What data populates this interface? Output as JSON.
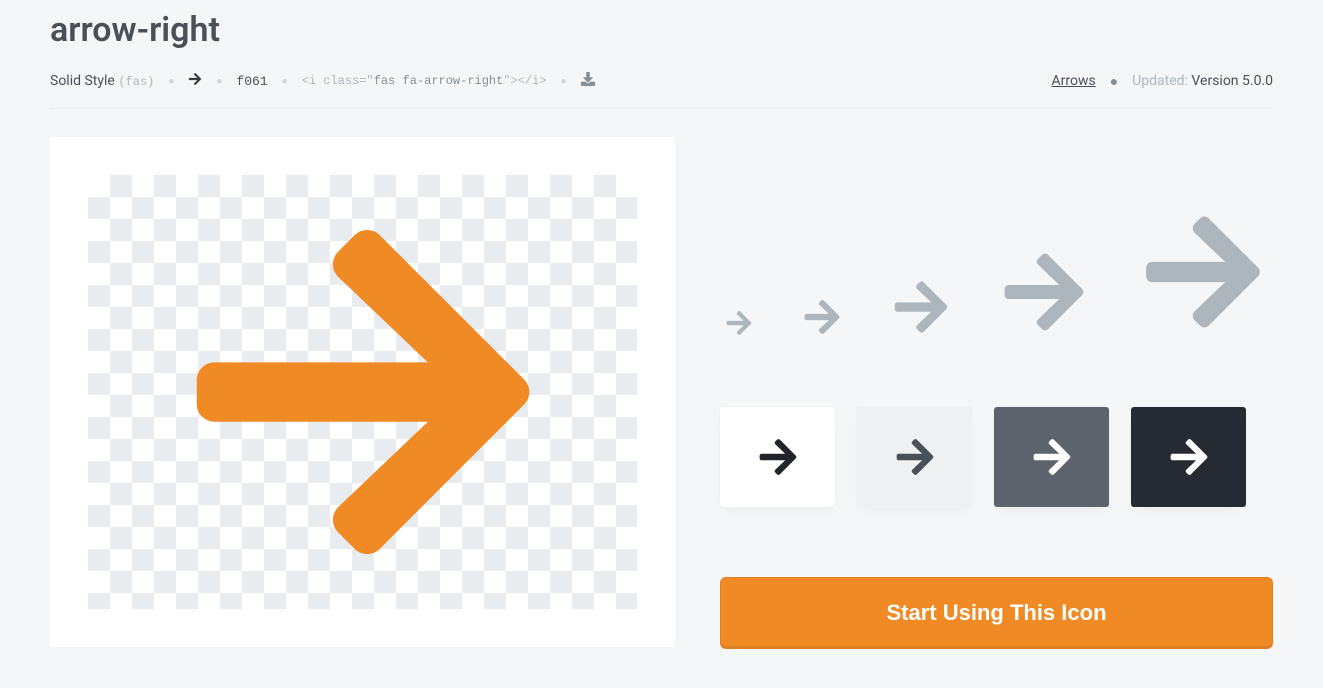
{
  "title": "arrow-right",
  "meta": {
    "style_label": "Solid Style",
    "style_code": "(fas)",
    "unicode": "f061",
    "code_prefix": "<i class=\"",
    "code_class": "fas fa-arrow-right",
    "code_suffix": "\"></i>",
    "category": "Arrows",
    "updated_label": "Updated:",
    "updated_value": "Version 5.0.0"
  },
  "cta_label": "Start Using This Icon",
  "colors": {
    "accent": "#f08a24",
    "muted": "#adb5bd",
    "swatch_dark": "#5c636d",
    "swatch_black": "#262a32"
  },
  "size_previews": [
    28,
    40,
    60,
    90,
    130
  ]
}
